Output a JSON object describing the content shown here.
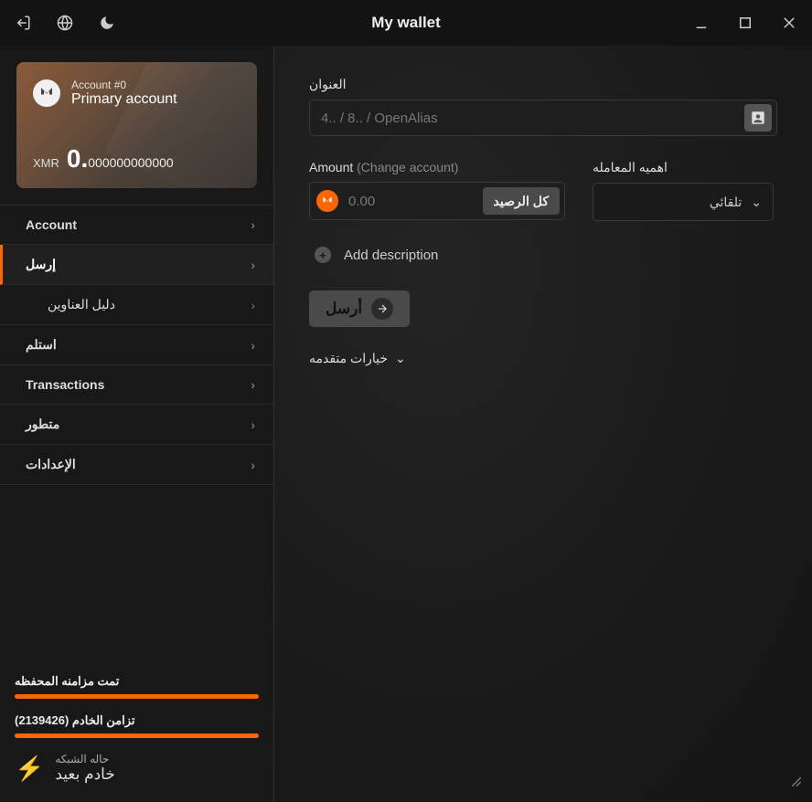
{
  "titlebar": {
    "title": "My wallet"
  },
  "account": {
    "number_label": "Account #0",
    "name": "Primary account",
    "currency": "XMR",
    "balance_major": "0.",
    "balance_minor": "000000000000"
  },
  "nav": {
    "account": "Account",
    "send": "إرسل",
    "address_book": "دليل العناوين",
    "receive": "استلم",
    "transactions": "Transactions",
    "advanced": "متطور",
    "settings": "الإعدادات"
  },
  "status": {
    "wallet_sync": "تمت مزامنه المحفظه",
    "daemon_sync": "تزامن الخادم (2139426)",
    "network_label": "حاله الشبكه",
    "network_value": "خادم بعيد"
  },
  "form": {
    "address_label": "العنوان",
    "address_placeholder": "4.. / 8.. / OpenAlias",
    "amount_label": "Amount",
    "amount_hint": "(Change account)",
    "amount_placeholder": "0.00",
    "all_button": "كل الرصيد",
    "priority_label": "اهميه المعامله",
    "priority_value": "تلقائي",
    "add_description": "Add description",
    "send_button": "أرسل",
    "advanced_toggle": "خيارات متقدمه"
  }
}
